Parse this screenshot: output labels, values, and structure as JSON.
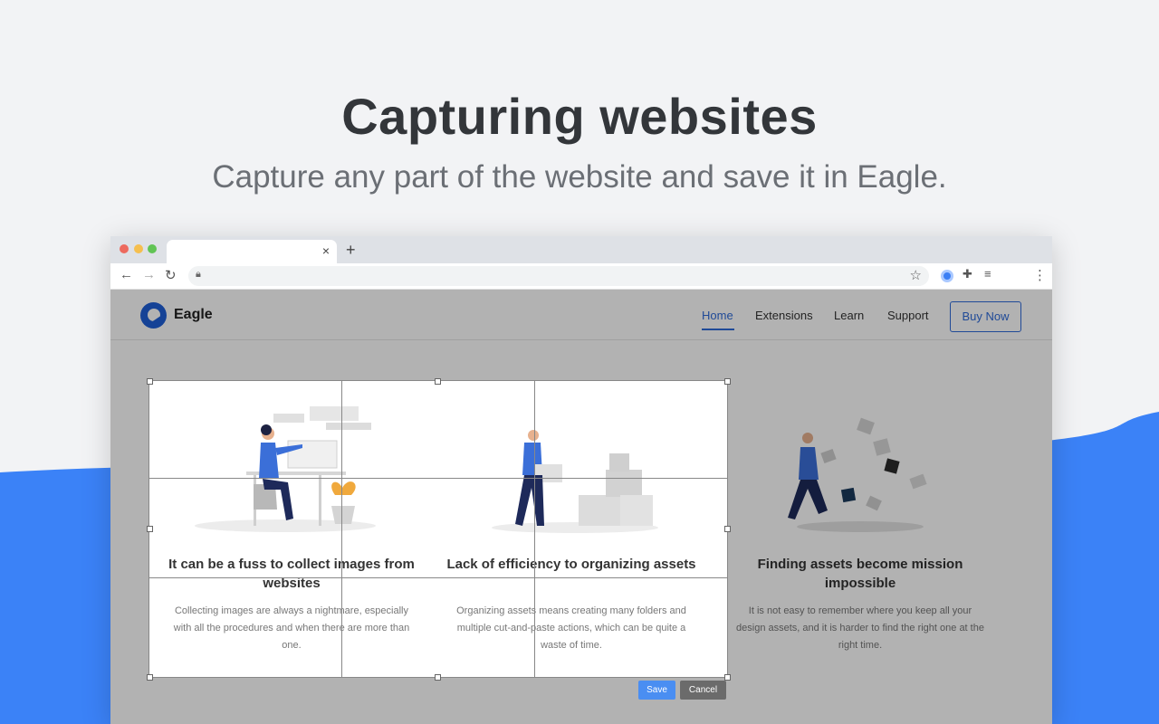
{
  "hero": {
    "title": "Capturing websites",
    "subtitle": "Capture any part of the website and save it in Eagle.",
    "accent_color": "#3b82f7"
  },
  "browser": {
    "tab_close_icon": "×",
    "new_tab_icon": "+",
    "toolbar_icons": [
      "back-icon",
      "forward-icon",
      "reload-icon",
      "lock-icon",
      "star-icon",
      "eagle-extension-icon",
      "puzzle-icon",
      "reading-list-icon",
      "more-icon"
    ]
  },
  "site": {
    "brand": "Eagle",
    "brand_color": "#1f5fd7",
    "nav": [
      "Home",
      "Extensions",
      "Learn",
      "Support"
    ],
    "buy_button": "Buy Now"
  },
  "cards": [
    {
      "title": "It can be a fuss to collect images from websites",
      "text": "Collecting images are always a nightmare, especially with all the procedures and when there are more than one."
    },
    {
      "title": "Lack of efficiency to organizing assets",
      "text": "Organizing assets means creating many folders and multiple cut-and-paste actions, which can be quite a waste of time."
    },
    {
      "title": "Finding assets become mission impossible",
      "text": "It is not easy to remember where you keep all your design assets, and it is harder to find the right one at the right time."
    }
  ],
  "capture": {
    "save": "Save",
    "cancel": "Cancel"
  }
}
